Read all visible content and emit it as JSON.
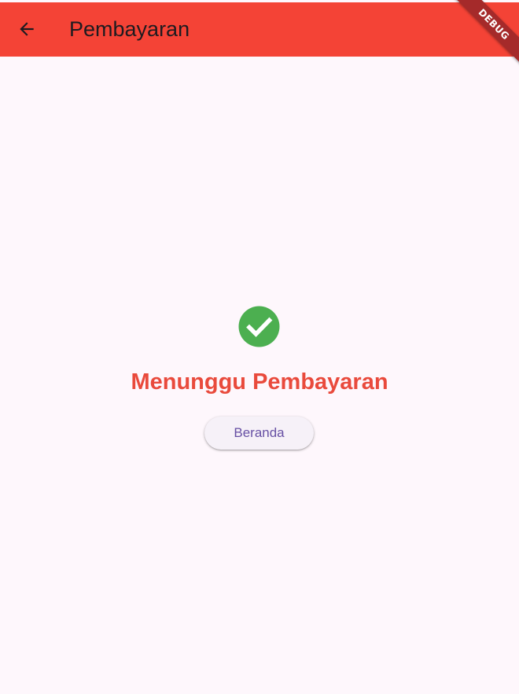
{
  "app_bar": {
    "title": "Pembayaran",
    "back_icon": "arrow-back-icon",
    "background_color": "#f44336"
  },
  "debug_banner": {
    "label": "DEBUG"
  },
  "main": {
    "status_icon": "check-circle-icon",
    "status_icon_color": "#4caf50",
    "status_title": "Menunggu Pembayaran",
    "status_title_color": "#e94a3c",
    "home_button_label": "Beranda"
  }
}
